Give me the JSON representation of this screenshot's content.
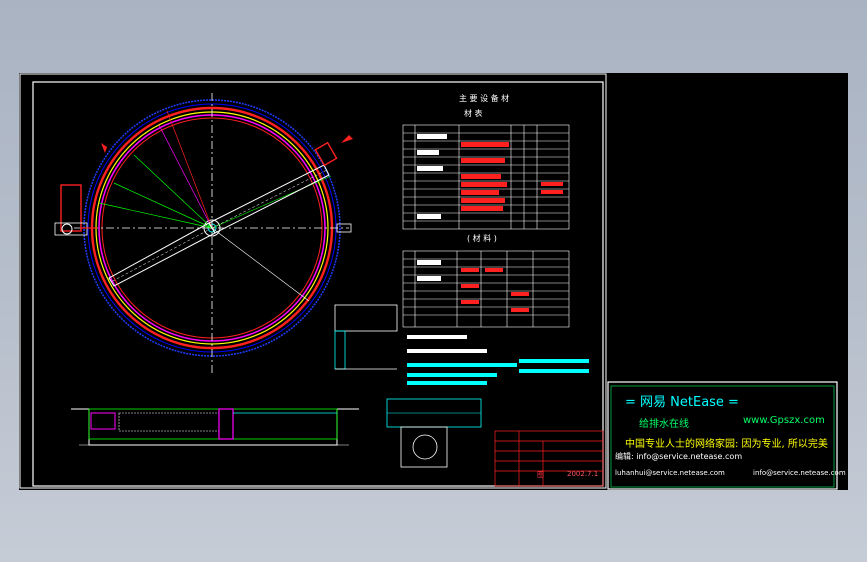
{
  "drawing": {
    "main_title": "主 要 设 备 材",
    "table1_title": "材 表",
    "table2_title": "( 材 料 )",
    "date": "2002.7.1",
    "scale_label": "图",
    "stamp": {
      "brand": "=  网易 NetEase  =",
      "site_name": "给排水在线",
      "site_url": "www.Gpszx.com",
      "slogan": "中国专业人士的网络家园: 因为专业, 所以完美",
      "email_line_1": "编辑: info@service.netease.com",
      "email_line_2": "luhanhui@service.netease.com",
      "email_line_3": "info@service.netease.com"
    }
  },
  "colors": {
    "background": "#000000",
    "frame": "#ffffff",
    "tank_ring_outer": "#0000ff",
    "tank_ring_red": "#ff2020",
    "tank_ring_magenta": "#ff00ff",
    "tank_ring_yellow": "#ffff00",
    "hatch": "#00ffff",
    "centerline": "#00ff00"
  }
}
